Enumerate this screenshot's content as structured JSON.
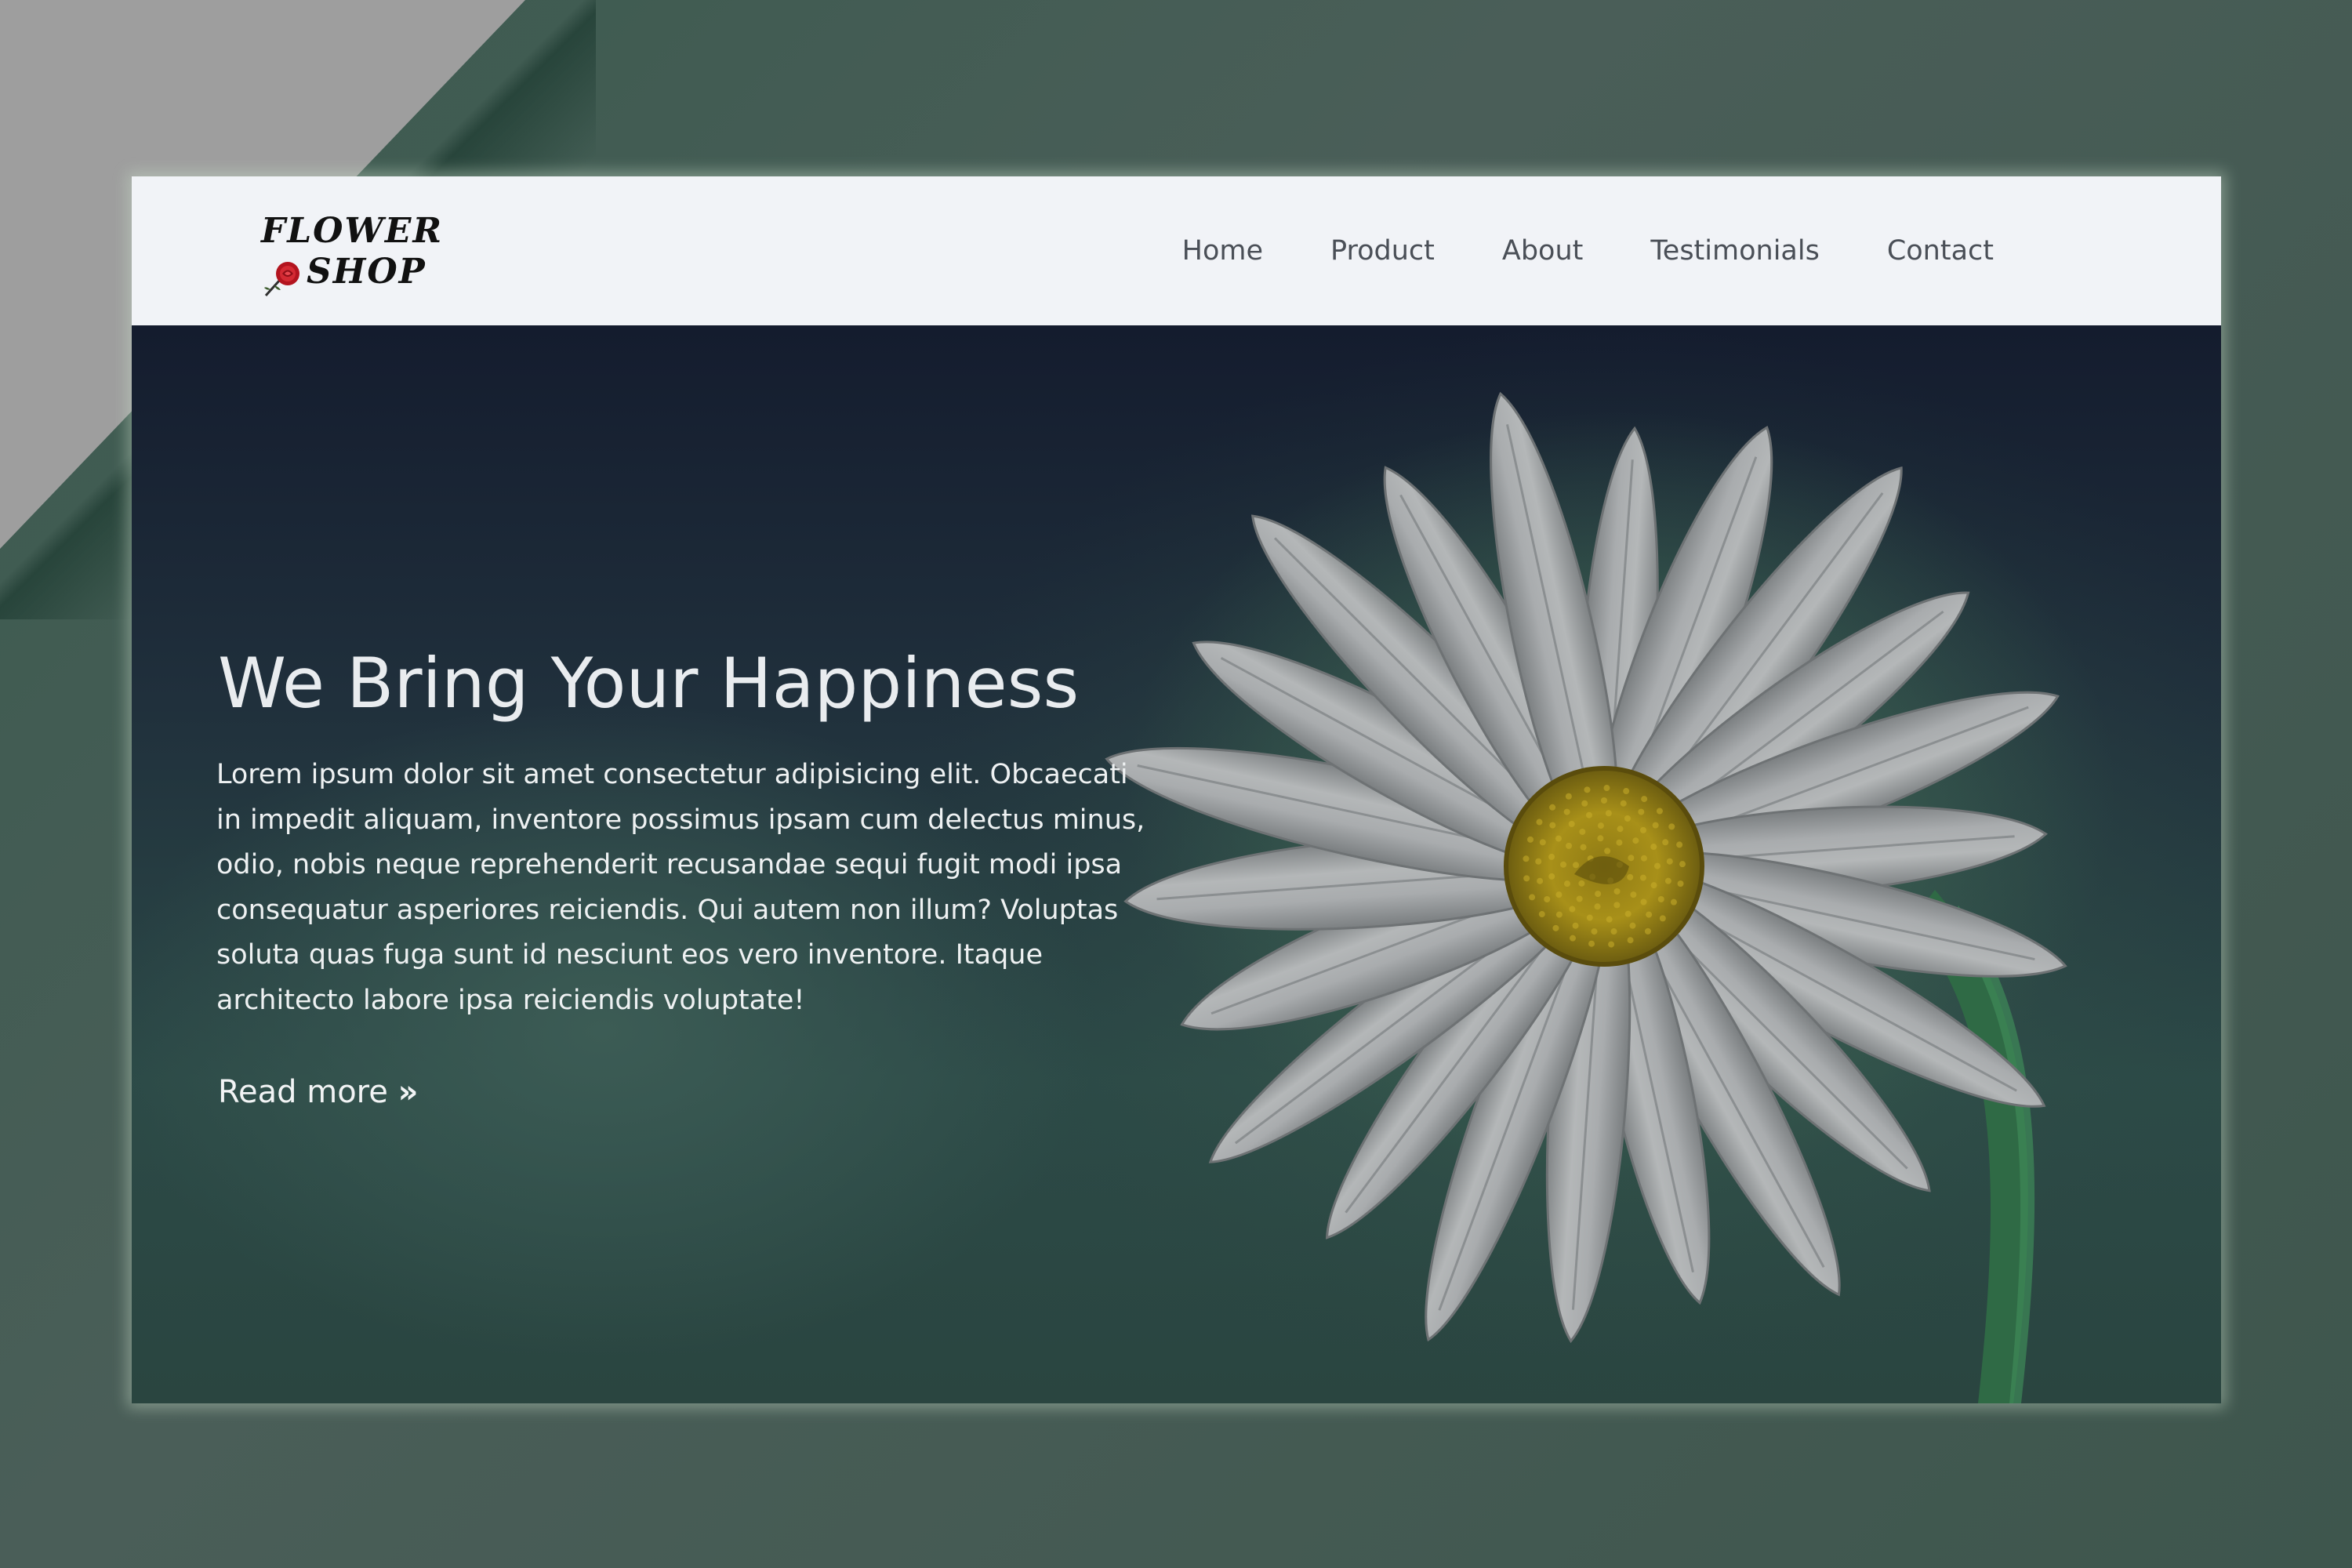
{
  "colors": {
    "background": "#3e564d",
    "navbar": "#f1f3f7",
    "nav_text": "#4a4f57",
    "hero_text": "#eef1f2",
    "corner": "#9e9e9e"
  },
  "logo": {
    "line1": "FLOWER",
    "line2": "SHOP",
    "icon": "rose-icon"
  },
  "nav": {
    "items": [
      {
        "label": "Home"
      },
      {
        "label": "Product"
      },
      {
        "label": "About"
      },
      {
        "label": "Testimonials"
      },
      {
        "label": "Contact"
      }
    ]
  },
  "hero": {
    "title": "We Bring Your Happiness",
    "body": "Lorem ipsum dolor sit amet consectetur adipisicing elit. Obcaecati in impedit aliquam, inventore possimus ipsam cum delectus minus, odio, nobis neque reprehenderit recusandae sequi fugit modi ipsa consequatur asperiores reiciendis. Qui autem non illum? Voluptas soluta quas fuga sunt id nesciunt eos vero inventore. Itaque architecto labore ipsa reiciendis voluptate!",
    "read_more": "Read more",
    "read_more_icon": "double-chevron-right-icon",
    "image": "daisy-flower-image"
  }
}
